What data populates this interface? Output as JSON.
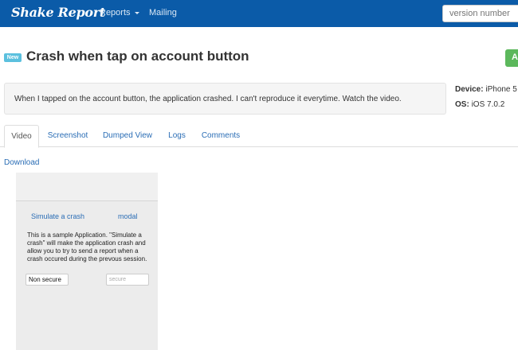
{
  "navbar": {
    "brand": "Shake Report",
    "reports_label": "Reports",
    "mailing_label": "Mailing",
    "search_placeholder": "version number",
    "bg_color": "#0b5ba8"
  },
  "report": {
    "badge": "New",
    "title": "Crash when tap on account button",
    "action_label": "A",
    "description": "When I tapped on the account button, the application crashed. I can't reproduce it everytime. Watch the video.",
    "device_label": "Device:",
    "device_value": "iPhone 5",
    "os_label": "OS:",
    "os_value": "iOS 7.0.2"
  },
  "tabs": [
    {
      "label": "Video",
      "active": true
    },
    {
      "label": "Screenshot",
      "active": false
    },
    {
      "label": "Dumped View",
      "active": false
    },
    {
      "label": "Logs",
      "active": false
    },
    {
      "label": "Comments",
      "active": false
    }
  ],
  "download_label": "Download",
  "phone": {
    "simulate_label": "Simulate a crash",
    "modal_label": "modal",
    "description": "This is a sample Application. \"Simulate a crash\" will make the application crash and allow you to try to send a report when a crash occured during the prevous session.",
    "non_secure_value": "Non secure",
    "secure_placeholder": "secure"
  },
  "colors": {
    "link": "#2a6db5",
    "badge": "#5bc0de",
    "action_button": "#5cb85c"
  }
}
